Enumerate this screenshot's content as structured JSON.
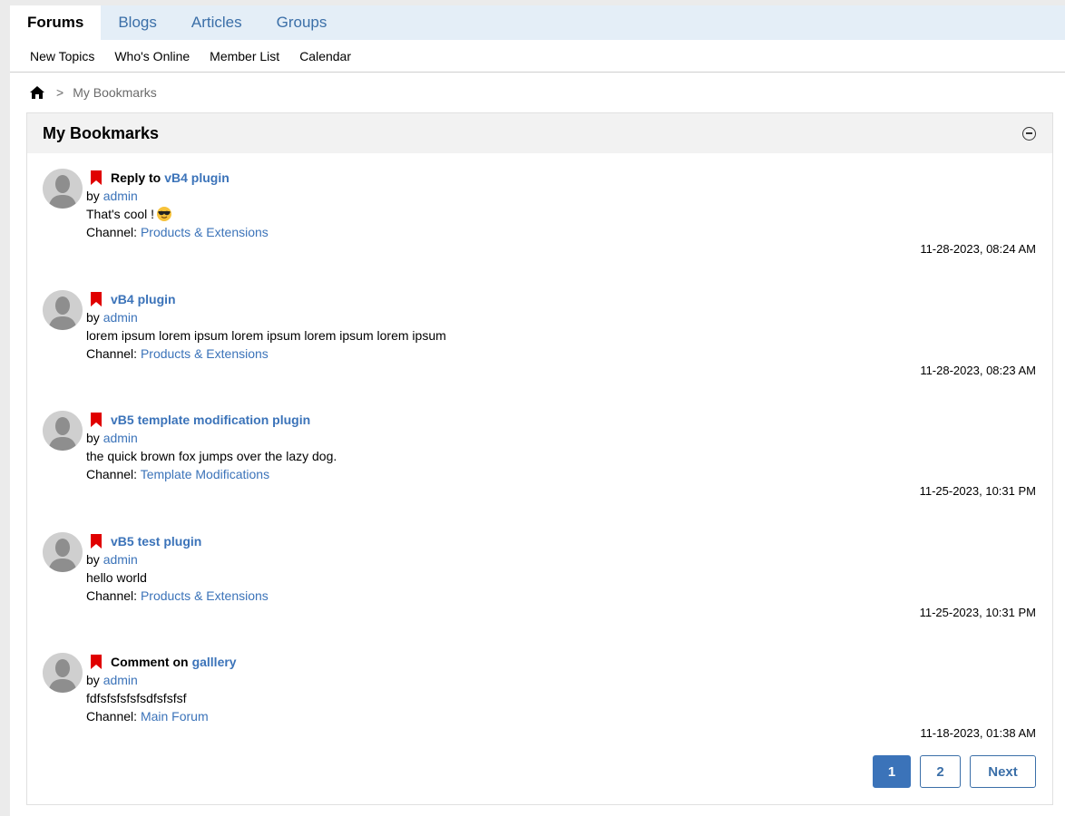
{
  "tabs": [
    "Forums",
    "Blogs",
    "Articles",
    "Groups"
  ],
  "subnav": [
    "New Topics",
    "Who's Online",
    "Member List",
    "Calendar"
  ],
  "breadcrumb": {
    "current": "My Bookmarks",
    "separator": ">"
  },
  "panel": {
    "title": "My Bookmarks"
  },
  "colors": {
    "accent": "#3b73b9",
    "bookmark": "#e00000",
    "tab_bar": "#e4eef7"
  },
  "bookmarks": [
    {
      "prefix": "Reply to",
      "title": "vB4 plugin",
      "by_label": "by",
      "author": "admin",
      "text": "That's cool !",
      "emoji": "sunglasses-emoji",
      "channel_label": "Channel:",
      "channel": "Products & Extensions",
      "date": "11-28-2023, 08:24 AM"
    },
    {
      "prefix": "",
      "title": "vB4 plugin",
      "by_label": "by",
      "author": "admin",
      "text": "lorem ipsum lorem ipsum lorem ipsum lorem ipsum lorem ipsum",
      "channel_label": "Channel:",
      "channel": "Products & Extensions",
      "date": "11-28-2023, 08:23 AM"
    },
    {
      "prefix": "",
      "title": "vB5 template modification plugin",
      "by_label": "by",
      "author": "admin",
      "text": "the quick brown fox jumps over the lazy dog.",
      "channel_label": "Channel:",
      "channel": "Template Modifications",
      "date": "11-25-2023, 10:31 PM"
    },
    {
      "prefix": "",
      "title": "vB5 test plugin",
      "by_label": "by",
      "author": "admin",
      "text": "hello world",
      "channel_label": "Channel:",
      "channel": "Products & Extensions",
      "date": "11-25-2023, 10:31 PM"
    },
    {
      "prefix": "Comment on",
      "title": "galllery",
      "by_label": "by",
      "author": "admin",
      "text": "fdfsfsfsfsfsdfsfsfsf",
      "channel_label": "Channel:",
      "channel": "Main Forum",
      "date": "11-18-2023, 01:38 AM"
    }
  ],
  "pagination": {
    "pages": [
      "1",
      "2"
    ],
    "current": "1",
    "next_label": "Next"
  }
}
